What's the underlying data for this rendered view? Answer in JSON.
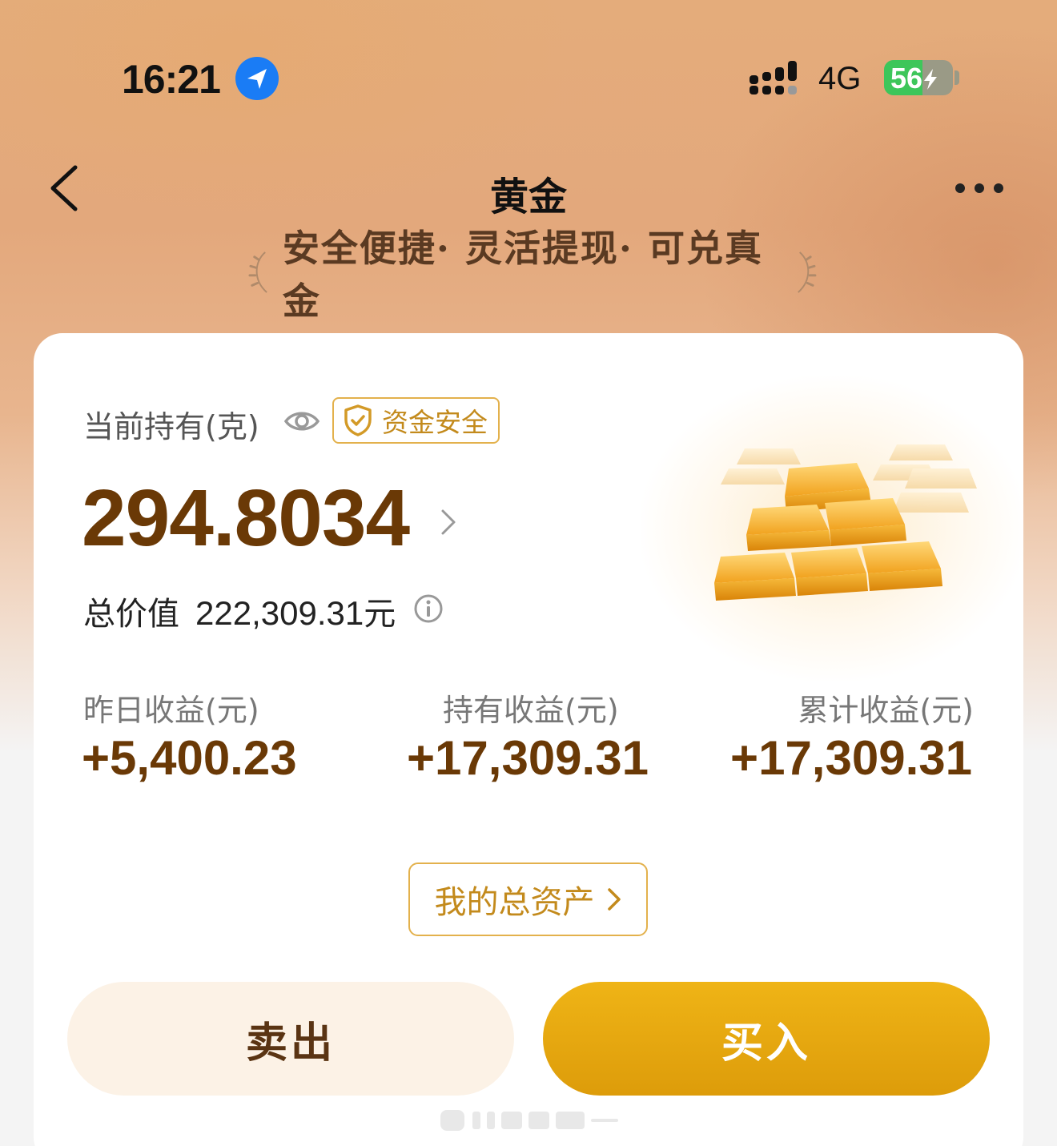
{
  "status_bar": {
    "time": "16:21",
    "network": "4G",
    "battery": "56",
    "battery_level": 0.56,
    "icons": [
      "location-arrow-icon",
      "signal-icon",
      "battery-charging-icon"
    ]
  },
  "nav": {
    "title": "黄金",
    "back_icon": "chevron-left-icon",
    "more_icon": "more-dots-icon"
  },
  "slogan": "安全便捷· 灵活提现· 可兑真金",
  "holding": {
    "label": "当前持有(克)",
    "badge": "资金安全",
    "value": "294.8034",
    "total_label": "总价值",
    "total_value": "222,309.31",
    "total_unit": "元"
  },
  "stats": [
    {
      "label": "昨日收益(元)",
      "value": "+5,400.23"
    },
    {
      "label": "持有收益(元)",
      "value": "+17,309.31"
    },
    {
      "label": "累计收益(元)",
      "value": "+17,309.31"
    }
  ],
  "assets_button": "我的总资产",
  "actions": {
    "sell": "卖出",
    "buy": "买入"
  },
  "colors": {
    "accent_gold": "#e3b14c",
    "value_brown": "#6a3906",
    "buy_button": "#e8a810",
    "sell_button_bg": "#fcf2e6",
    "battery_green": "#3dc65a",
    "location_blue": "#1a7cf5"
  }
}
